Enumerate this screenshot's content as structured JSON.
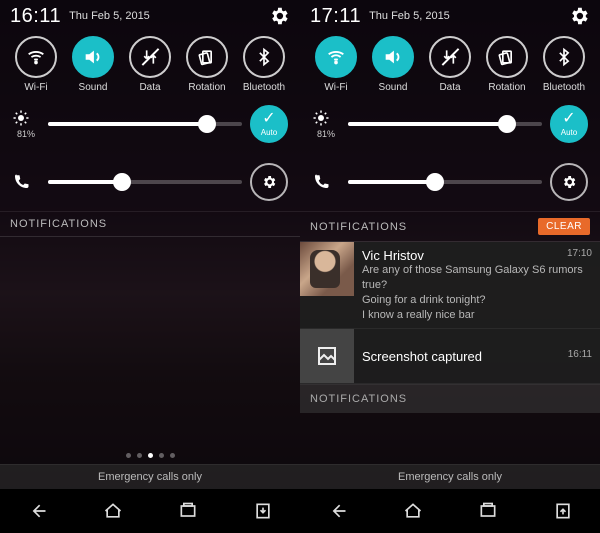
{
  "left": {
    "time": "16:11",
    "date": "Thu Feb 5, 2015",
    "qs": [
      {
        "key": "wifi",
        "label": "Wi-Fi",
        "active": false,
        "strike": false
      },
      {
        "key": "sound",
        "label": "Sound",
        "active": true,
        "strike": false
      },
      {
        "key": "data",
        "label": "Data",
        "active": false,
        "strike": true
      },
      {
        "key": "rotation",
        "label": "Rotation",
        "active": false,
        "strike": false
      },
      {
        "key": "bluetooth",
        "label": "Bluetooth",
        "active": false,
        "strike": false
      }
    ],
    "brightness": {
      "percent_label": "81%",
      "value": 82,
      "auto_label": "Auto"
    },
    "volume": {
      "value": 38
    },
    "notif_header": "NOTIFICATIONS",
    "emergency": "Emergency calls only"
  },
  "right": {
    "time": "17:11",
    "date": "Thu Feb 5, 2015",
    "qs": [
      {
        "key": "wifi",
        "label": "Wi-Fi",
        "active": true,
        "strike": false
      },
      {
        "key": "sound",
        "label": "Sound",
        "active": true,
        "strike": false
      },
      {
        "key": "data",
        "label": "Data",
        "active": false,
        "strike": true
      },
      {
        "key": "rotation",
        "label": "Rotation",
        "active": false,
        "strike": false
      },
      {
        "key": "bluetooth",
        "label": "Bluetooth",
        "active": false,
        "strike": false
      }
    ],
    "brightness": {
      "percent_label": "81%",
      "value": 82,
      "auto_label": "Auto"
    },
    "volume": {
      "value": 45
    },
    "notif_header": "NOTIFICATIONS",
    "clear_label": "CLEAR",
    "notifications": [
      {
        "sender": "Vic Hristov",
        "time": "17:10",
        "lines": [
          "Are any of those Samsung Galaxy S6 rumors true?",
          "Going for a drink tonight?",
          "I know a really nice bar"
        ]
      },
      {
        "title": "Screenshot captured",
        "time": "16:11"
      }
    ],
    "sub_header": "NOTIFICATIONS",
    "emergency": "Emergency calls only"
  },
  "icons": {
    "wifi": "wifi-icon",
    "sound": "sound-icon",
    "data": "data-icon",
    "rotation": "rotation-icon",
    "bluetooth": "bluetooth-icon",
    "gear": "gear-icon",
    "brightness": "brightness-icon",
    "phone": "phone-icon",
    "image": "image-icon",
    "check": "check-icon"
  }
}
